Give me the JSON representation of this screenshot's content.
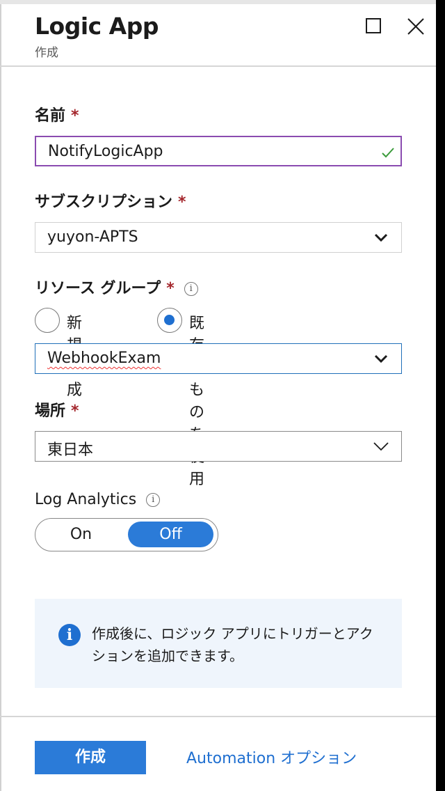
{
  "header": {
    "title": "Logic App",
    "subtitle": "作成"
  },
  "form": {
    "name": {
      "label": "名前",
      "required": "*",
      "value": "NotifyLogicApp"
    },
    "subscription": {
      "label": "サブスクリプション",
      "required": "*",
      "value": "yuyon-APTS"
    },
    "resource_group": {
      "label": "リソース グループ",
      "required": "*",
      "info": "i",
      "options": [
        "新規作成",
        "既存のものを使用"
      ],
      "selected_option": "既存のものを使用",
      "value": "WebhookExam"
    },
    "location": {
      "label": "場所",
      "required": "*",
      "value": "東日本"
    },
    "log_analytics": {
      "label": "Log Analytics",
      "info": "i",
      "on_label": "On",
      "off_label": "Off",
      "selected": "Off"
    }
  },
  "info_box": {
    "icon": "i",
    "text": "作成後に、ロジック アプリにトリガーとアクションを追加できます。"
  },
  "footer": {
    "create_label": "作成",
    "automation_label": "Automation オプション"
  },
  "colors": {
    "accent": "#2b7bd8",
    "required": "#a4262c",
    "name_border": "#8a4bb0",
    "valid_check": "#3a9b3a"
  }
}
